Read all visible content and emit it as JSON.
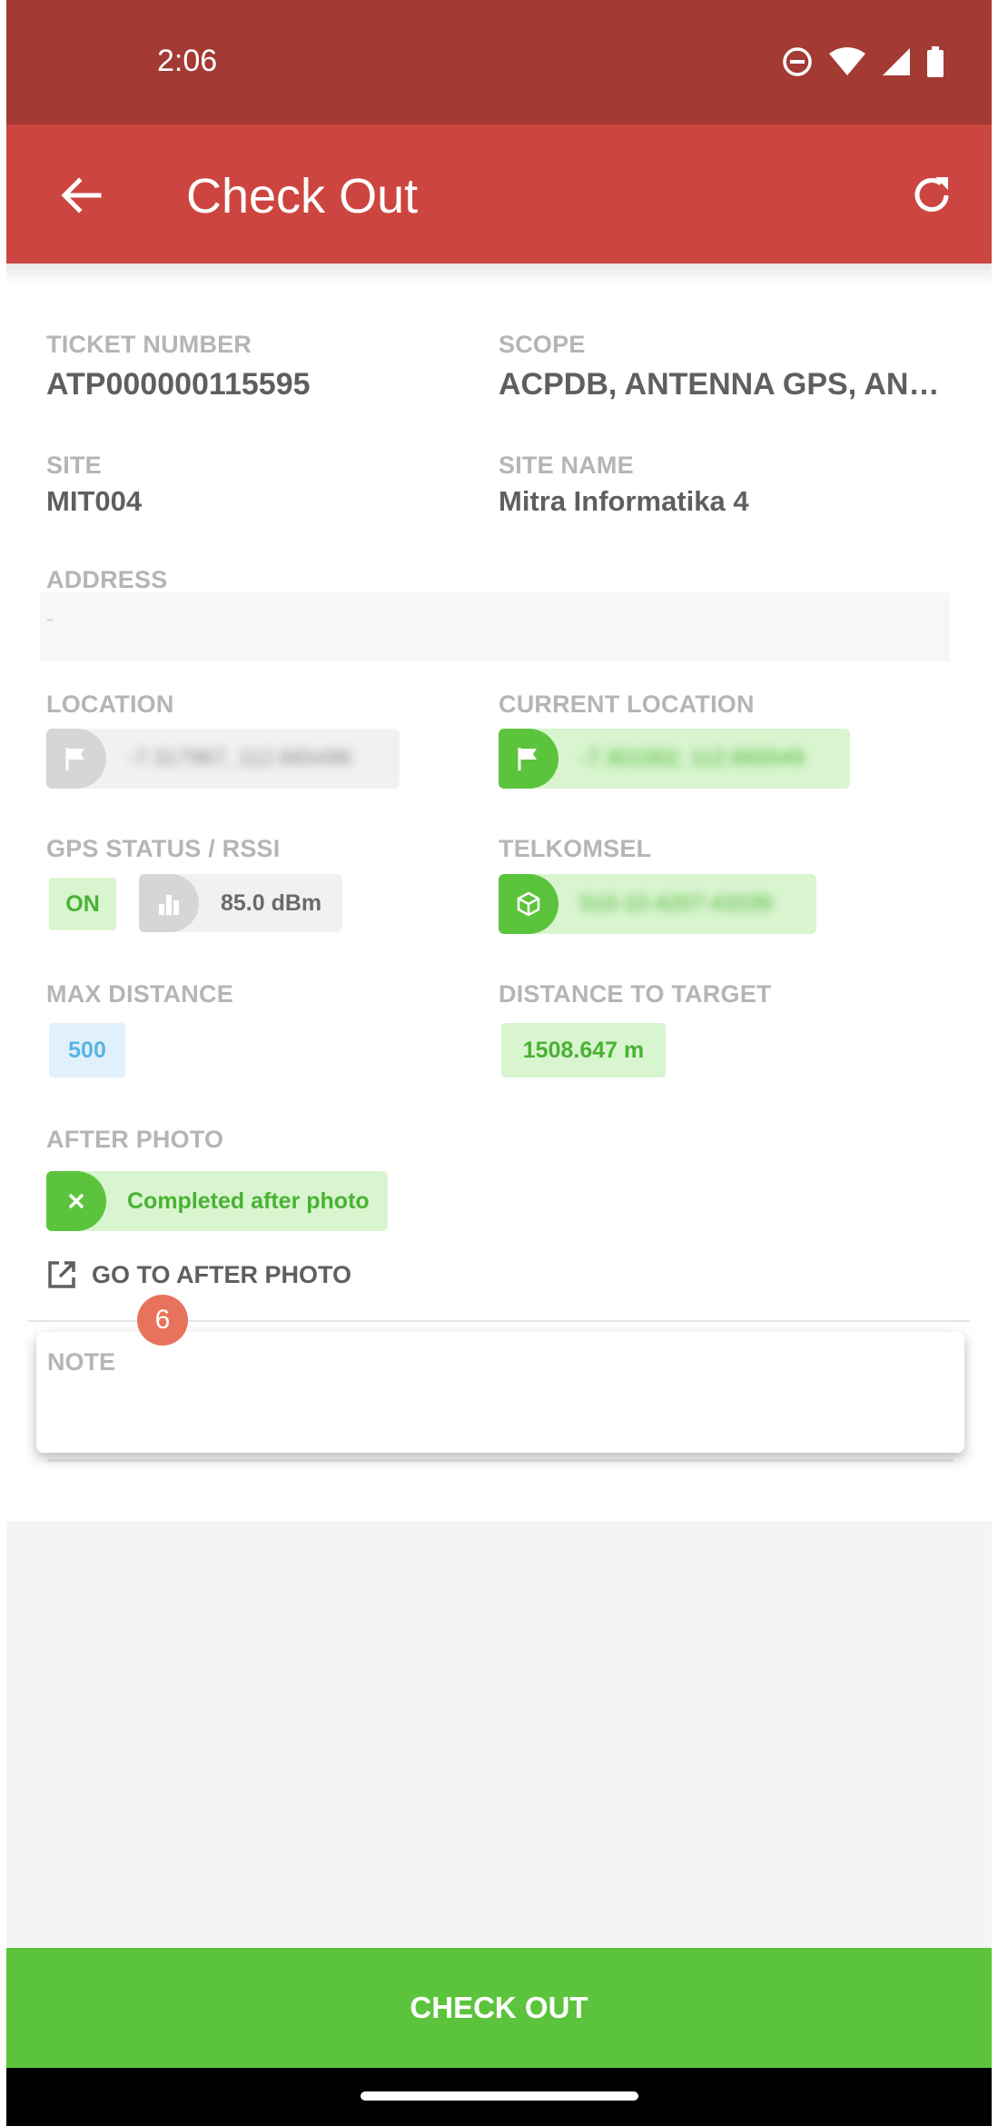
{
  "status_bar": {
    "time": "2:06"
  },
  "app_bar": {
    "title": "Check Out"
  },
  "fields": {
    "ticket_number": {
      "label": "TICKET NUMBER",
      "value": "ATP000000115595"
    },
    "scope": {
      "label": "SCOPE",
      "value": "ACPDB, ANTENNA GPS, AN…"
    },
    "site": {
      "label": "SITE",
      "value": "MIT004"
    },
    "site_name": {
      "label": "SITE NAME",
      "value": "Mitra Informatika 4"
    },
    "address": {
      "label": "ADDRESS",
      "value": "-"
    },
    "location": {
      "label": "LOCATION",
      "value": "-7.317967, 112.665496"
    },
    "current_location": {
      "label": "CURRENT LOCATION",
      "value": "-7.301002, 112.665549"
    },
    "gps_status": {
      "label": "GPS STATUS / RSSI",
      "gps": "ON",
      "rssi": "85.0 dBm"
    },
    "telkomsel": {
      "label": "TELKOMSEL",
      "value": "510-10-4207-43339"
    },
    "max_distance": {
      "label": "MAX DISTANCE",
      "value": "500"
    },
    "distance_to_target": {
      "label": "DISTANCE TO TARGET",
      "value": "1508.647 m"
    },
    "after_photo": {
      "label": "AFTER PHOTO",
      "status": "Completed after photo",
      "link": "GO TO AFTER PHOTO"
    }
  },
  "badge": {
    "count": "6"
  },
  "note": {
    "label": "NOTE",
    "value": ""
  },
  "checkout_button": {
    "label": "CHECK OUT"
  },
  "colors": {
    "status_bar": "#a33a34",
    "app_bar": "#cd4540",
    "accent_green": "#5bc43c",
    "chip_green_bg": "#d8f5cf",
    "chip_blue_text": "#5ab4e4",
    "badge": "#e8735c"
  },
  "icons": {
    "status": [
      "do-not-disturb-icon",
      "wifi-icon",
      "cell-signal-icon",
      "battery-icon"
    ],
    "back": "arrow-left-icon",
    "refresh": "refresh-icon",
    "location": "flag-icon",
    "rssi": "signal-bars-icon",
    "telkomsel": "cube-icon",
    "after_photo": "close-icon",
    "goto": "external-link-icon"
  }
}
